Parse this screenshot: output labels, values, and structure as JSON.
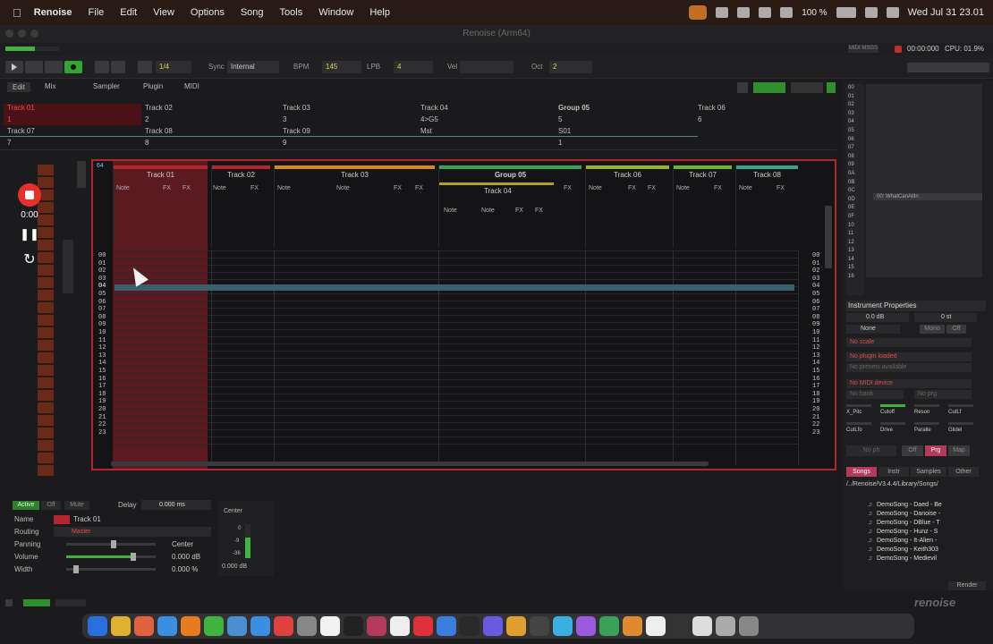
{
  "menubar": {
    "app": "Renoise",
    "items": [
      "File",
      "Edit",
      "View",
      "Options",
      "Song",
      "Tools",
      "Window",
      "Help"
    ],
    "battery": "100 %",
    "datetime": "Wed Jul 31  23.01"
  },
  "window": {
    "title": "Renoise (Arm64)"
  },
  "status": {
    "time": "00:00:000",
    "cpu": "CPU: 01.9%",
    "midi": "MIDI MSGS"
  },
  "toolbar": {
    "pattern_label": "1/4",
    "sync_label": "Sync",
    "sync_value": "Internal",
    "bpm_label": "BPM",
    "bpm_value": "145",
    "lpb_label": "LPB",
    "lpb_value": "4",
    "vel_label": "Vel",
    "oct_label": "Oct",
    "oct_value": "2"
  },
  "tabs": [
    "Edit",
    "Mix",
    "Sampler",
    "Plugin",
    "MIDI"
  ],
  "sequencer": {
    "row1": [
      "Track 01",
      "Track 02",
      "Track 03",
      "Track 04",
      "Group 05",
      "Track 06"
    ],
    "row2": [
      "1",
      "2",
      "3",
      "4>G5",
      "5",
      "6"
    ],
    "row3": [
      "Track 07",
      "Track 08",
      "Track 09",
      "Mst",
      "S01"
    ],
    "row4": [
      "7",
      "8",
      "9",
      "",
      "1"
    ]
  },
  "pattern": {
    "tracks": [
      {
        "name": "Track 01",
        "color": "#b3262d"
      },
      {
        "name": "Track 02",
        "color": "#b3262d"
      },
      {
        "name": "Track 03",
        "color": "#d48a1f"
      },
      {
        "name": "Group 05",
        "color": "#3aa15a"
      },
      {
        "name": "Track 06",
        "color": "#9bb327"
      },
      {
        "name": "Track 07",
        "color": "#6fb32e"
      },
      {
        "name": "Track 08",
        "color": "#3aa18a"
      }
    ],
    "track04_name": "Track 04",
    "col_note": "Note",
    "col_fx": "FX",
    "pattern_number": "64",
    "rows": [
      "00",
      "01",
      "02",
      "03",
      "04",
      "05",
      "06",
      "07",
      "08",
      "09",
      "10",
      "11",
      "12",
      "13",
      "14",
      "15",
      "16",
      "17",
      "18",
      "19",
      "20",
      "21",
      "22",
      "23"
    ]
  },
  "recorder": {
    "time": "0:00"
  },
  "right": {
    "instrument_list": [
      "00",
      "01",
      "02",
      "03",
      "04",
      "05",
      "06",
      "07",
      "08",
      "09",
      "0A",
      "0B",
      "0C",
      "0D",
      "0E",
      "0F",
      "10",
      "11",
      "12",
      "13",
      "14",
      "15",
      "16"
    ],
    "selected_instrument": "00: WhatCanAllIn",
    "props_title": "Instrument Properties",
    "vol": "0.0 dB",
    "tune": "0 st",
    "none_label": "None",
    "mono_label": "Mono",
    "off_label": "Off",
    "scale": "No scale",
    "plugin": "No plugin loaded",
    "plugin_sub": "No presets available",
    "midi": "No MIDI device",
    "midi_bank": "No bank",
    "midi_prg": "No prg",
    "knobs": [
      "X_Pitc",
      "Cutoff",
      "Reson",
      "CutLf",
      "CutLfo",
      "Drive",
      "Paralle",
      "Glidel"
    ],
    "nph": "No ph",
    "prg": "Prg",
    "map": "Map",
    "browser_tabs": [
      "Songs",
      "Instr",
      "Samples",
      "Other"
    ],
    "path": "/../Renoise/V3.4.4/Library/Songs/",
    "songs": [
      "DemoSong - Daed - Be",
      "DemoSong - Danoise -",
      "DemoSong - DBlue - T",
      "DemoSong - Hunz - S",
      "DemoSong - It-Alien -",
      "DemoSong - Keith303",
      "DemoSong - Medievil"
    ],
    "render": "Render"
  },
  "bottom": {
    "active": "Active",
    "off": "Off",
    "mute": "Mute",
    "delay_label": "Delay",
    "delay_value": "0.000 ms",
    "name_label": "Name",
    "name_value": "Track 01",
    "routing_label": "Routing",
    "routing_value": "Master",
    "panning_label": "Panning",
    "panning_value": "Center",
    "volume_label": "Volume",
    "volume_value": "0.000 dB",
    "width_label": "Width",
    "width_value": "0.000 %",
    "center_label": "Center",
    "meter_0": "0",
    "meter_m9": "-9",
    "meter_m36": "-36",
    "meter_db": "0.000 dB",
    "edit_step": "1"
  },
  "brand": "renoise"
}
